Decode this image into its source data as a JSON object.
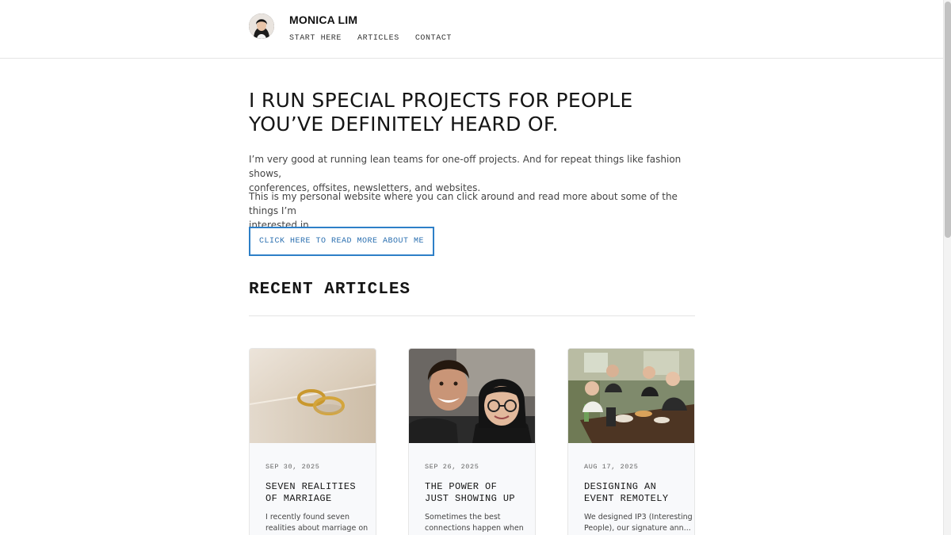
{
  "header": {
    "site_title": "MONICA LIM",
    "nav": [
      "START HERE",
      "ARTICLES",
      "CONTACT"
    ]
  },
  "hero": {
    "heading_lines": [
      "I RUN SPECIAL PROJECTS FOR PEOPLE",
      "YOU’VE DEFINITELY HEARD OF."
    ],
    "paragraph_1_lines": [
      "I’m very good at running lean teams for one-off projects. And for repeat things like fashion shows,",
      "conferences, offsites, newsletters, and websites."
    ],
    "paragraph_2_lines": [
      "This is my personal website where you can click around and read more about some of the things I’m",
      "interested in."
    ],
    "cta_label": "CLICK HERE TO READ MORE ABOUT ME"
  },
  "recent_articles": {
    "title": "RECENT ARTICLES",
    "items": [
      {
        "date": "SEP 30, 2025",
        "title_lines": [
          "SEVEN REALITIES",
          "OF MARRIAGE"
        ],
        "excerpt_lines": [
          "I recently found seven",
          "realities about marriage on"
        ],
        "image": "wedding-rings-photo"
      },
      {
        "date": "SEP 26, 2025",
        "title_lines": [
          "THE POWER OF",
          "JUST SHOWING UP"
        ],
        "excerpt_lines": [
          "Sometimes the best",
          "connections happen when"
        ],
        "image": "selfie-two-people-photo"
      },
      {
        "date": "AUG 17, 2025",
        "title_lines": [
          "DESIGNING AN",
          "EVENT REMOTELY"
        ],
        "excerpt_lines": [
          "We designed IP3 (Interesting",
          "People), our signature ann..."
        ],
        "image": "group-dinner-photo"
      }
    ]
  },
  "colors": {
    "accent": "#2d7fc7",
    "text": "#151515",
    "border": "#e5e5e5",
    "card_bg": "#f8f9fb"
  }
}
